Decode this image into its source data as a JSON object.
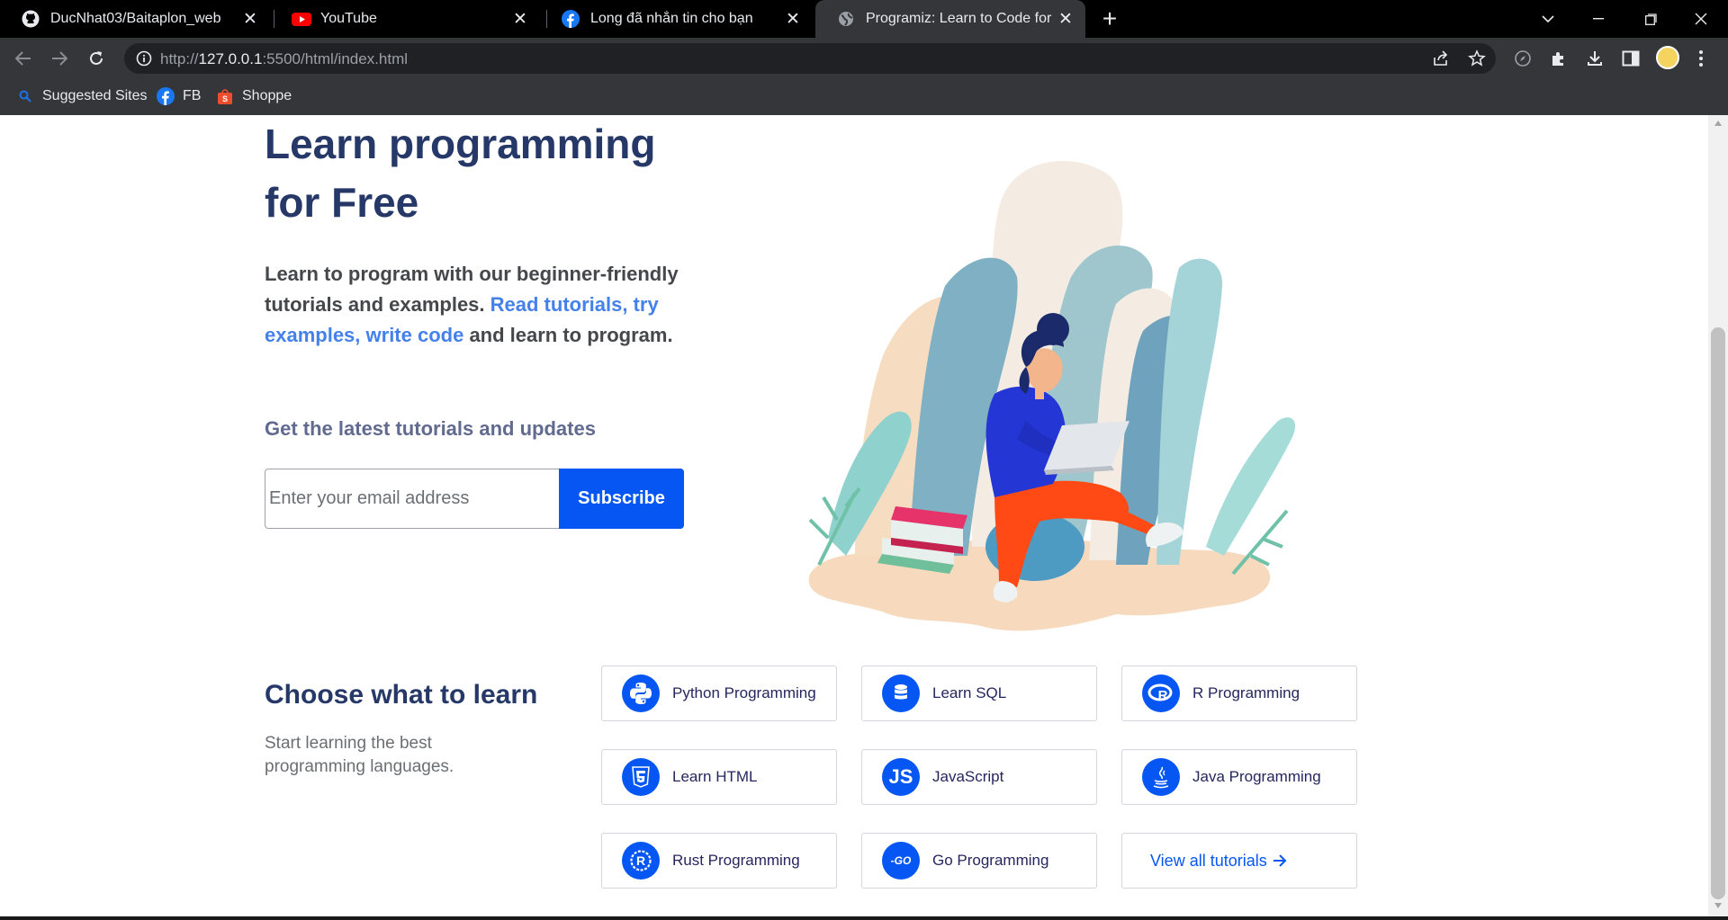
{
  "browser": {
    "tabs": [
      {
        "title": "DucNhat03/Baitaplon_web",
        "icon": "github-icon",
        "active": false
      },
      {
        "title": "YouTube",
        "icon": "youtube-icon",
        "active": false
      },
      {
        "title": "Long đã nhắn tin cho bạn",
        "icon": "facebook-icon",
        "active": false
      },
      {
        "title": "Programiz: Learn to Code for Free",
        "icon": "globe-icon",
        "active": true
      }
    ],
    "url_scheme": "http://",
    "url_host": "127.0.0.1",
    "url_rest": ":5500/html/index.html",
    "bookmarks": [
      {
        "label": "Suggested Sites",
        "icon": "search-icon"
      },
      {
        "label": "FB",
        "icon": "facebook-icon"
      },
      {
        "label": "Shoppe",
        "icon": "shopee-icon"
      }
    ],
    "colors": {
      "tab_strip": "#000000",
      "toolbar": "#35363a",
      "omnibox": "#202124"
    }
  },
  "hero": {
    "title_line1": "Learn programming",
    "title_line2": "for Free",
    "desc_part1": "Learn to program with our beginner-friendly tutorials and examples. ",
    "desc_link": "Read tutorials, try examples, write code",
    "desc_part2": " and learn to program.",
    "updates_label": "Get the latest tutorials and updates",
    "email_placeholder": "Enter your email address",
    "subscribe_label": "Subscribe"
  },
  "learn": {
    "title": "Choose what to learn",
    "subtitle": "Start learning the best programming languages.",
    "courses": [
      {
        "label": "Python Programming",
        "icon": "python-icon"
      },
      {
        "label": "Learn SQL",
        "icon": "database-icon"
      },
      {
        "label": "R Programming",
        "icon": "r-icon"
      },
      {
        "label": "Learn HTML",
        "icon": "html5-icon"
      },
      {
        "label": "JavaScript",
        "icon": "js-icon"
      },
      {
        "label": "Java Programming",
        "icon": "java-icon"
      },
      {
        "label": "Rust Programming",
        "icon": "rust-icon"
      },
      {
        "label": "Go Programming",
        "icon": "go-icon"
      }
    ],
    "view_all_label": "View all tutorials",
    "js_icon_text": "JS",
    "go_icon_text": "-GO",
    "r_icon_text": "R"
  },
  "colors": {
    "heading": "#253867",
    "accent": "#0556f3",
    "link": "#4581ea"
  }
}
